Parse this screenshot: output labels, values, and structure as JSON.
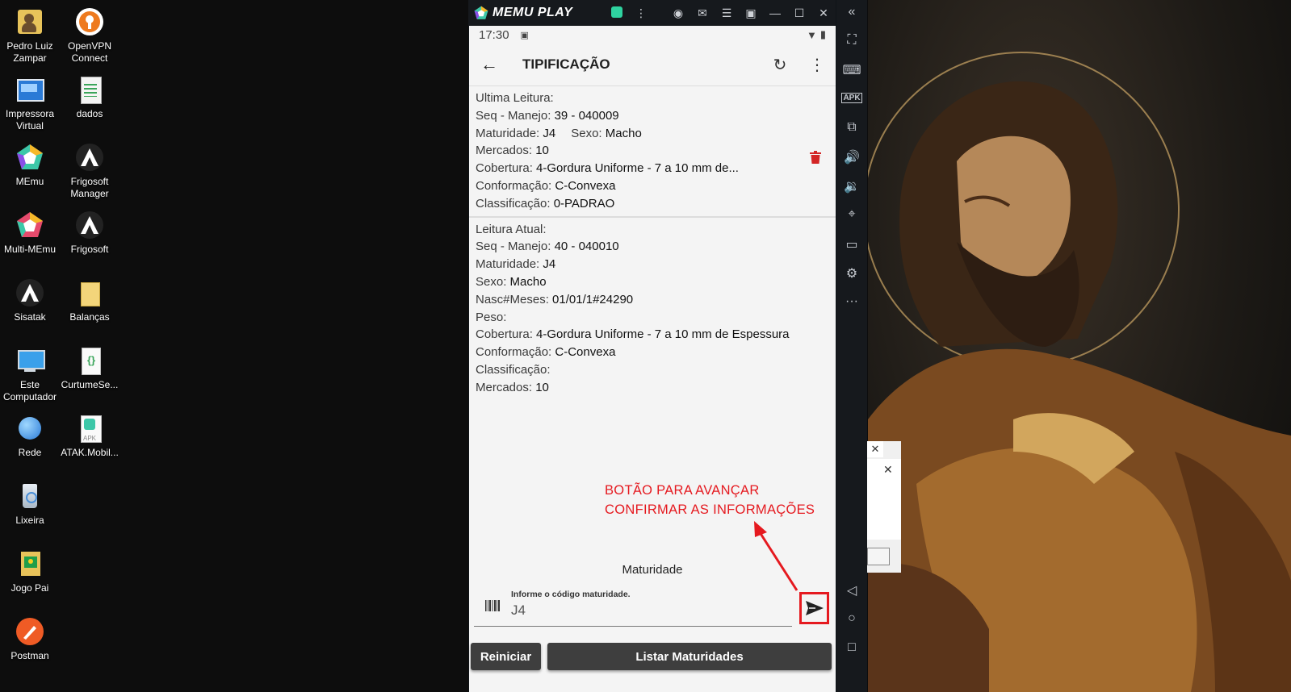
{
  "desktop": {
    "icons": [
      {
        "label": "Pedro Luiz Zampar",
        "icon": "user-folder-icon"
      },
      {
        "label": "OpenVPN Connect",
        "icon": "openvpn-icon"
      },
      {
        "label": "Impressora Virtual",
        "icon": "printer-icon"
      },
      {
        "label": "dados",
        "icon": "spreadsheet-icon"
      },
      {
        "label": "MEmu",
        "icon": "memu-icon"
      },
      {
        "label": "Frigosoft Manager",
        "icon": "frigosoft-icon"
      },
      {
        "label": "Multi-MEmu",
        "icon": "multi-memu-icon"
      },
      {
        "label": "Frigosoft",
        "icon": "frigosoft-icon"
      },
      {
        "label": "Sisatak",
        "icon": "sisatak-icon"
      },
      {
        "label": "Balanças",
        "icon": "folder-icon"
      },
      {
        "label": "Este Computador",
        "icon": "computer-icon"
      },
      {
        "label": "CurtumeSe...",
        "icon": "json-file-icon"
      },
      {
        "label": "Rede",
        "icon": "network-icon"
      },
      {
        "label": "ATAK.Mobil...",
        "icon": "apk-file-icon"
      },
      {
        "label": "Lixeira",
        "icon": "recycle-bin-icon"
      },
      {
        "label": "Jogo Pai",
        "icon": "game-folder-icon"
      },
      {
        "label": "Postman",
        "icon": "postman-icon"
      }
    ]
  },
  "emulator": {
    "brand": "MEMU PLAY",
    "sidebar_icons": [
      "collapse-icon",
      "fullscreen-icon",
      "keyboard-icon",
      "apk-icon",
      "add-window-icon",
      "volume-up-icon",
      "volume-down-icon",
      "location-icon",
      "folder-icon",
      "settings-icon",
      "more-icon",
      "nav-back-icon",
      "nav-home-icon",
      "nav-recents-icon"
    ]
  },
  "android": {
    "status": {
      "time": "17:30"
    },
    "appbar": {
      "title": "TIPIFICAÇÃO"
    },
    "last_reading": {
      "heading": "Ultima Leitura:",
      "seq_label": "Seq - Manejo: ",
      "seq_value": "39 - 040009",
      "maturidade_label": "Maturidade: ",
      "maturidade_value": "J4",
      "sexo_label": "Sexo: ",
      "sexo_value": "Macho",
      "mercados_label": "Mercados: ",
      "mercados_value": "10",
      "cobertura_label": "Cobertura: ",
      "cobertura_value": "4-Gordura Uniforme - 7 a 10 mm de...",
      "conformacao_label": "Conformação: ",
      "conformacao_value": "C-Convexa",
      "classificacao_label": "Classificação: ",
      "classificacao_value": "0-PADRAO"
    },
    "current_reading": {
      "heading": "Leitura Atual:",
      "seq_label": "Seq - Manejo: ",
      "seq_value": "40 - 040010",
      "maturidade_label": "Maturidade: ",
      "maturidade_value": "J4",
      "sexo_label": "Sexo: ",
      "sexo_value": "Macho",
      "nasc_label": "Nasc#Meses: ",
      "nasc_value": "01/01/1#24290",
      "peso_label": "Peso:",
      "cobertura_label": "Cobertura: ",
      "cobertura_value": "4-Gordura Uniforme - 7 a 10 mm de Espessura",
      "conformacao_label": "Conformação: ",
      "conformacao_value": "C-Convexa",
      "classificacao_label": "Classificação:",
      "mercados_label": "Mercados: ",
      "mercados_value": "10"
    },
    "input": {
      "section_label": "Maturidade",
      "hint": "Informe o código maturidade.",
      "value": "J4"
    },
    "buttons": {
      "restart": "Reiniciar",
      "list": "Listar Maturidades"
    }
  },
  "annotation": {
    "line1": "BOTÃO PARA AVANÇAR",
    "line2": "CONFIRMAR AS INFORMAÇÕES",
    "color": "#e5191f"
  }
}
